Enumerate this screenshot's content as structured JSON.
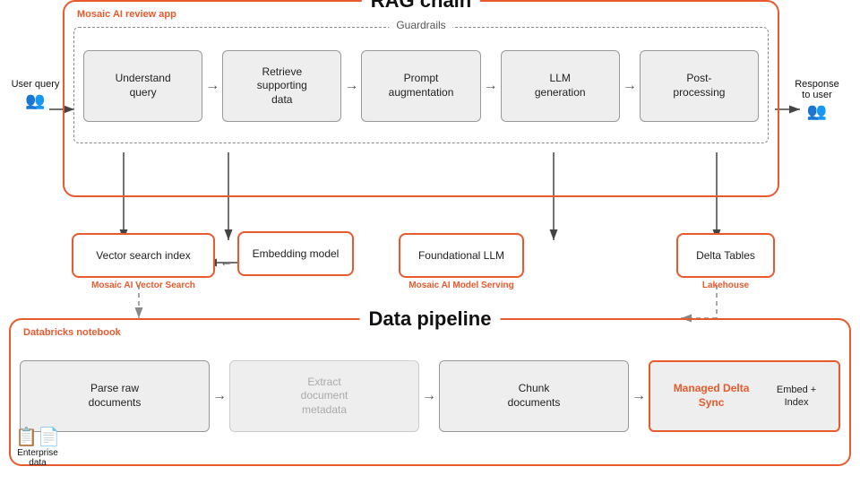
{
  "diagram": {
    "rag_chain": {
      "title": "RAG chain",
      "mosaic_label": "Mosaic AI review app",
      "guardrails_label": "Guardrails",
      "steps": [
        {
          "id": "understand",
          "label": "Understand query"
        },
        {
          "id": "retrieve",
          "label": "Retrieve supporting data"
        },
        {
          "id": "prompt",
          "label": "Prompt augmentation"
        },
        {
          "id": "llm-gen",
          "label": "LLM generation"
        },
        {
          "id": "post",
          "label": "Post-processing"
        }
      ]
    },
    "user_query": {
      "label": "User query",
      "icon": "👥"
    },
    "response_user": {
      "label": "Response to user",
      "icon": "👥"
    },
    "bottom_row": [
      {
        "id": "vector",
        "label": "Vector search index",
        "sub": "Mosaic AI Vector Search"
      },
      {
        "id": "embedding",
        "label": "Embedding model",
        "sub": ""
      },
      {
        "id": "foundational",
        "label": "Foundational LLM",
        "sub": "Mosaic AI Model Serving"
      },
      {
        "id": "delta-tables",
        "label": "Delta Tables",
        "sub": "Lakehouse"
      }
    ],
    "data_pipeline": {
      "title": "Data pipeline",
      "databricks_label": "Databricks notebook",
      "steps": [
        {
          "id": "parse",
          "label": "Parse raw documents",
          "faded": false,
          "highlight": false
        },
        {
          "id": "extract",
          "label": "Extract document metadata",
          "faded": true,
          "highlight": false
        },
        {
          "id": "chunk",
          "label": "Chunk documents",
          "faded": false,
          "highlight": false
        },
        {
          "id": "managed",
          "label": "Managed Delta Sync\nEmbed + Index",
          "faded": false,
          "highlight": true
        }
      ]
    },
    "enterprise_data": {
      "label": "Enterprise data",
      "icon": "📋"
    }
  }
}
